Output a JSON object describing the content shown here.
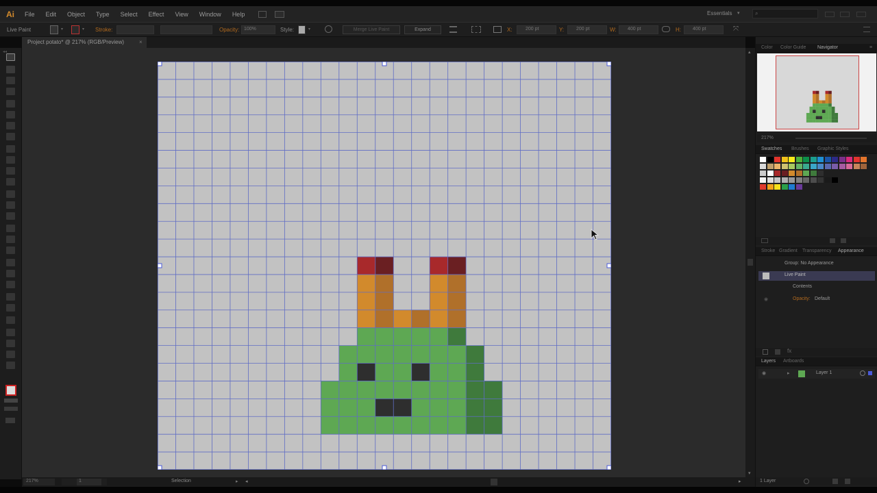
{
  "app": {
    "logo": "Ai"
  },
  "menu": [
    "File",
    "Edit",
    "Object",
    "Type",
    "Select",
    "Effect",
    "View",
    "Window",
    "Help"
  ],
  "workspace": {
    "label": "Essentials"
  },
  "control_bar": {
    "selection_label": "Live Paint",
    "stroke_label": "Stroke:",
    "opacity_label": "Opacity:",
    "opacity_value": "100%",
    "style_label": "Style:",
    "merge_button": "Merge Live Paint",
    "expand_button": "Expand",
    "x_label": "X:",
    "x_value": "200 pt",
    "y_label": "Y:",
    "y_value": "200 pt",
    "w_label": "W:",
    "w_value": "400 pt",
    "h_label": "H:",
    "h_value": "400 pt"
  },
  "document": {
    "tab_title": "Project potato* @ 217% (RGB/Preview)",
    "close": "×"
  },
  "status": {
    "zoom": "217%",
    "page": "1",
    "tool": "Selection"
  },
  "artwork": {
    "grid_cols": 25,
    "grid_rows": 23,
    "background_color": "#c2c2c2",
    "grid_line_color": "#5f6cc4",
    "colors": {
      "R": "#a8292b",
      "r": "#6a1f22",
      "O": "#d28a2c",
      "o": "#b0702a",
      "G": "#5ea853",
      "g": "#3f7a3c",
      "K": "#2e2e2e"
    },
    "pixel_rows": [
      {
        "row": 11,
        "start": 11,
        "pixels": "Rr..Rr"
      },
      {
        "row": 12,
        "start": 11,
        "pixels": "Oo..Oo"
      },
      {
        "row": 13,
        "start": 11,
        "pixels": "Oo..Oo"
      },
      {
        "row": 14,
        "start": 11,
        "pixels": "OoOoOo"
      },
      {
        "row": 15,
        "start": 11,
        "pixels": "GGGGGg"
      },
      {
        "row": 16,
        "start": 10,
        "pixels": "GGGGGGGg"
      },
      {
        "row": 17,
        "start": 10,
        "pixels": "GKGGKGGg"
      },
      {
        "row": 18,
        "start": 9,
        "pixels": "GGGGGGGGgg"
      },
      {
        "row": 19,
        "start": 9,
        "pixels": "GGGKKGGGgg"
      },
      {
        "row": 20,
        "start": 9,
        "pixels": "GGGGGGGGgg"
      }
    ]
  },
  "panels": {
    "color_tabs": [
      "Color",
      "Color Guide",
      "Navigator"
    ],
    "navigator_zoom": "217%",
    "swatch_tabs": [
      "Swatches",
      "Brushes",
      "Graphic Styles"
    ],
    "swatch_colors": [
      [
        "#ffffff",
        "#000000",
        "#e2332b",
        "#f0c21a",
        "#f7ea1a",
        "#4cae3a",
        "#0c8f4a",
        "#1b9e8f",
        "#1f8fd3",
        "#1a55a8",
        "#2d2a87",
        "#7b2f89",
        "#d92a7b",
        "#e3342f",
        "#e5752c"
      ],
      [
        "#d9d9d9",
        "#bf9f6c",
        "#eab36a",
        "#d0c26f",
        "#a7c960",
        "#63b266",
        "#3aa98f",
        "#3aa6c9",
        "#4a88c8",
        "#5a68b0",
        "#7a5ca9",
        "#a75aa1",
        "#d86a9a",
        "#c8855c",
        "#a0643b"
      ],
      [
        "#cccccc",
        "#ffffff",
        "#a8292b",
        "#6a1f22",
        "#d28a2c",
        "#b0702a",
        "#5ea853",
        "#3f7a3c",
        "#2e2e2e"
      ],
      [
        "#f5f5f5",
        "#e0e0e0",
        "#c8c8c8",
        "#b0b0b0",
        "#999999",
        "#808080",
        "#666666",
        "#4d4d4d",
        "#333333",
        "#1a1a1a",
        "#000000"
      ],
      [
        "#e03a2d",
        "#f2a31b",
        "#f6e11c",
        "#2aa04a",
        "#1f7ad0",
        "#6a3a9a"
      ]
    ],
    "appearance_tabs": [
      "Stroke",
      "Gradient",
      "Transparency",
      "Appearance"
    ],
    "appearance": {
      "group_label": "Group: No Appearance",
      "item_label": "Live Paint",
      "contents_label": "Contents",
      "opacity_label": "Opacity:",
      "opacity_value": "Default"
    },
    "layers_tabs": [
      "Layers",
      "Artboards"
    ],
    "layer_name": "Layer 1",
    "layers_count": "1 Layer"
  }
}
